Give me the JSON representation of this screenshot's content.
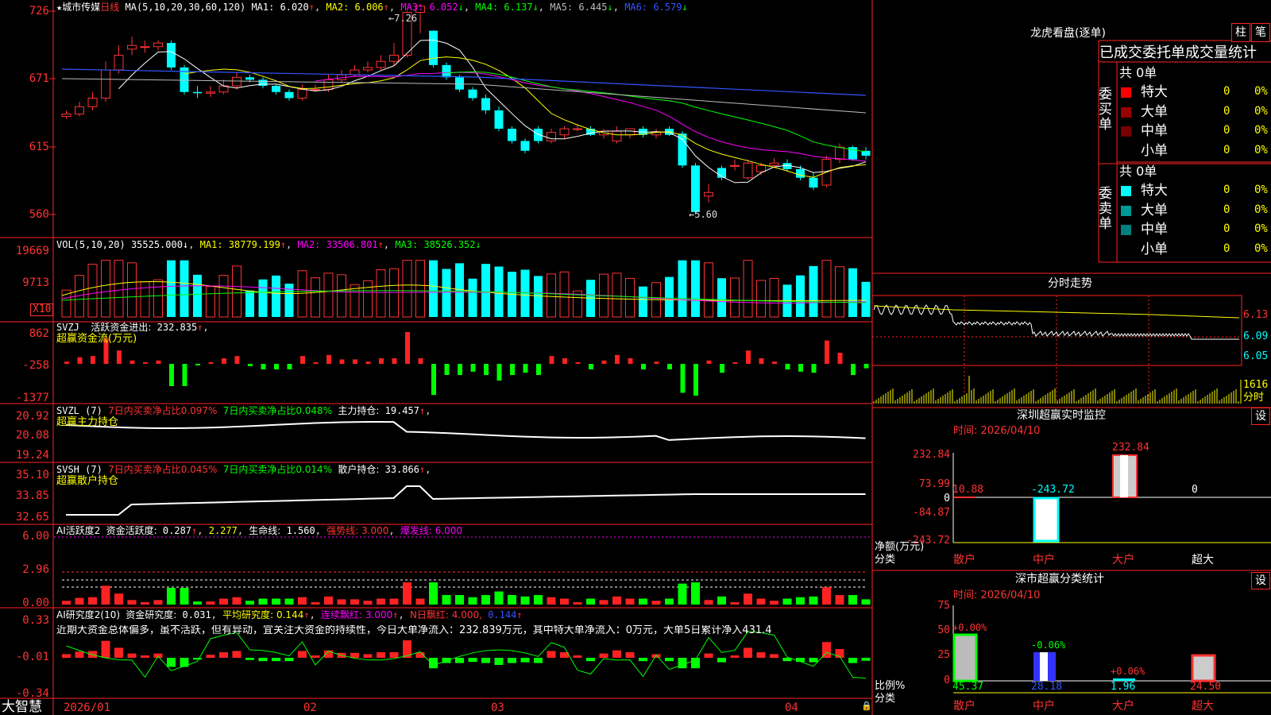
{
  "app_logo": "大智慧",
  "kline": {
    "star": "★",
    "name": "城市传媒",
    "period": "日线",
    "ma_params": "MA(5,10,20,30,60,120)",
    "ma": [
      {
        "label": "MA1:",
        "value": "6.020",
        "arrow": "↑",
        "color": "#ffffff"
      },
      {
        "label": "MA2:",
        "value": "6.006",
        "arrow": "↑",
        "color": "#ffff00"
      },
      {
        "label": "MA3:",
        "value": "6.052",
        "arrow": "↓",
        "color": "#ff00ff"
      },
      {
        "label": "MA4:",
        "value": "6.137",
        "arrow": "↓",
        "color": "#00ff00"
      },
      {
        "label": "MA5:",
        "value": "6.445",
        "arrow": "↓",
        "color": "#bbbbbb"
      },
      {
        "label": "MA6:",
        "value": "6.579",
        "arrow": "↓",
        "color": "#3355ff"
      }
    ],
    "y_ticks": [
      "726",
      "671",
      "615",
      "560"
    ],
    "high_label": "7.26",
    "low_label": "5.60"
  },
  "volume": {
    "params": "VOL(5,10,20)",
    "value": "35525.000",
    "value_arrow": "↓",
    "ma": [
      {
        "label": "MA1:",
        "value": "38779.199",
        "arrow": "↑",
        "color": "#ffff00"
      },
      {
        "label": "MA2:",
        "value": "33506.801",
        "arrow": "↑",
        "color": "#ff00ff"
      },
      {
        "label": "MA3:",
        "value": "38526.352",
        "arrow": "↓",
        "color": "#00ff00"
      }
    ],
    "y_ticks": [
      "19669",
      "9713"
    ],
    "unit": "X10"
  },
  "svzj": {
    "name": "SVZJ",
    "label": "活跃资金进出:",
    "value": "232.835",
    "arrow": "↑",
    "subtitle": "超赢资金流(万元)",
    "y_ticks": [
      "862",
      "-258",
      "-1377"
    ]
  },
  "svzl": {
    "name": "SVZL",
    "param": "(7)",
    "t1": "7日内买卖净占比0.097%",
    "t2": "7日内买卖净占比0.048%",
    "label": "主力持仓:",
    "value": "19.457",
    "subtitle": "超赢主力持仓",
    "y_ticks": [
      "20.92",
      "20.08",
      "19.24"
    ]
  },
  "svsh": {
    "name": "SVSH",
    "param": "(7)",
    "t1": "7日内买卖净占比0.045%",
    "t2": "7日内买卖净占比0.014%",
    "label": "散户持仓:",
    "value": "33.866",
    "subtitle": "超赢散户持仓",
    "y_ticks": [
      "35.10",
      "33.85",
      "32.65"
    ]
  },
  "ai_active": {
    "name": "AI活跃度2",
    "label": "资金活跃度:",
    "v1": "0.287",
    "v2": "2.277",
    "life_label": "生命线:",
    "life_value": "1.560",
    "strong": "强势线: 3.000",
    "burst": "爆发线: 6.000",
    "y_ticks": [
      "6.00",
      "2.96",
      "0.00"
    ]
  },
  "ai_research": {
    "name": "AI研究度2(10)",
    "label": "资金研究度:",
    "value": "0.031",
    "avg": "平均研究度: 0.144",
    "streak": "连续飘红: 3.000",
    "nday": "N日飘红: 4.000,",
    "last": "0.144",
    "comment": "近期大资金总体偏多，虽不活跃，但有异动，宜关注大资金的持续性，今日大单净流入：232.839万元，其中特大单净流入：0万元，大单5日累计净入431.4",
    "y_ticks": [
      "0.33",
      "-0.01",
      "-0.34"
    ]
  },
  "x_axis": [
    "2026/01",
    "02",
    "03",
    "04"
  ],
  "right": {
    "dragon_title": "龙虎看盘(逐单)",
    "btn_zhu": "柱",
    "btn_bi": "笔",
    "stat_title": "已成交委托单成交量统计",
    "buy_side": "委买单",
    "sell_side": "委卖单",
    "buy_total": "共 0单",
    "sell_total": "共 0单",
    "buy_rows": [
      {
        "label": "特大",
        "count": "0",
        "pct": "0%",
        "color": "#ff0000"
      },
      {
        "label": "大单",
        "count": "0",
        "pct": "0%",
        "color": "#990000"
      },
      {
        "label": "中单",
        "count": "0",
        "pct": "0%",
        "color": "#770000"
      },
      {
        "label": "小单",
        "count": "0",
        "pct": "0%",
        "color": "#000000"
      }
    ],
    "sell_rows": [
      {
        "label": "特大",
        "count": "0",
        "pct": "0%",
        "color": "#00ffff"
      },
      {
        "label": "大单",
        "count": "0",
        "pct": "0%",
        "color": "#009999"
      },
      {
        "label": "中单",
        "count": "0",
        "pct": "0%",
        "color": "#008080"
      },
      {
        "label": "小单",
        "count": "0",
        "pct": "0%",
        "color": "#000000"
      }
    ],
    "intraday_title": "分时走势",
    "intraday_prices": [
      "6.13",
      "6.09",
      "6.05"
    ],
    "intraday_vol": "1616",
    "intraday_unit": "分时",
    "monitor_title": "深圳超赢实时监控",
    "monitor_btn": "设",
    "monitor_time": "时间: 2026/04/10",
    "monitor_y": [
      "232.84",
      "73.99",
      "0",
      "-84.87",
      "-243.72"
    ],
    "monitor_bar_vals": [
      "10.88",
      "-243.72",
      "232.84",
      "0"
    ],
    "monitor_ylabel": "净额(万元)",
    "monitor_xlabel": "分类",
    "cats": [
      "散户",
      "中户",
      "大户",
      "超大"
    ],
    "class_title": "深市超赢分类统计",
    "class_btn": "设",
    "class_time": "时间: 2026/04/10",
    "class_y": [
      "75",
      "50",
      "25",
      "0"
    ],
    "class_top": [
      "+0.00%",
      "-0.06%",
      "+0.06%",
      ""
    ],
    "class_vals": [
      "45.37",
      "28.18",
      "1.96",
      "24.50"
    ],
    "class_ylabel": "比例%",
    "class_xlabel": "分类"
  },
  "chart_data": [
    {
      "type": "candlestick",
      "title": "城市传媒 日线",
      "ylim": [
        5.5,
        7.35
      ],
      "open": [
        6.4,
        6.42,
        6.48,
        6.55,
        6.78,
        6.95,
        6.97,
        6.97,
        7.0,
        6.8,
        6.6,
        6.59,
        6.6,
        6.65,
        6.72,
        6.7,
        6.65,
        6.6,
        6.55,
        6.62,
        6.62,
        6.7,
        6.74,
        6.78,
        6.8,
        6.85,
        6.9,
        7.25,
        7.1,
        6.82,
        6.72,
        6.62,
        6.55,
        6.45,
        6.3,
        6.2,
        6.3,
        6.2,
        6.25,
        6.3,
        6.3,
        6.25,
        6.2,
        6.25,
        6.3,
        6.25,
        6.3,
        6.26,
        6.0,
        5.75,
        5.98,
        6.0,
        5.9,
        5.95,
        6.0,
        6.02,
        5.97,
        5.9,
        5.84,
        6.05,
        6.15,
        6.12
      ],
      "close": [
        6.42,
        6.48,
        6.55,
        6.78,
        6.9,
        6.98,
        6.97,
        7.0,
        6.8,
        6.6,
        6.59,
        6.6,
        6.65,
        6.72,
        6.7,
        6.65,
        6.6,
        6.55,
        6.62,
        6.62,
        6.7,
        6.74,
        6.78,
        6.8,
        6.85,
        6.9,
        7.25,
        7.3,
        6.82,
        6.72,
        6.62,
        6.55,
        6.45,
        6.3,
        6.2,
        6.12,
        6.2,
        6.27,
        6.3,
        6.3,
        6.25,
        6.28,
        6.28,
        6.3,
        6.25,
        6.27,
        6.25,
        6.0,
        5.62,
        5.78,
        5.9,
        6.0,
        6.02,
        6.0,
        6.02,
        5.97,
        5.9,
        5.82,
        6.05,
        6.15,
        6.05,
        6.08
      ],
      "high": [
        6.45,
        6.52,
        6.6,
        6.85,
        6.98,
        7.05,
        7.02,
        7.02,
        7.02,
        6.82,
        6.65,
        6.65,
        6.7,
        6.76,
        6.74,
        6.72,
        6.66,
        6.62,
        6.66,
        6.66,
        6.74,
        6.78,
        6.82,
        6.85,
        6.9,
        7.0,
        7.26,
        7.32,
        7.1,
        6.84,
        6.74,
        6.64,
        6.58,
        6.48,
        6.32,
        6.22,
        6.32,
        6.3,
        6.32,
        6.33,
        6.32,
        6.3,
        6.32,
        6.3,
        6.32,
        6.3,
        6.32,
        6.28,
        6.02,
        5.85,
        6.0,
        6.05,
        6.05,
        6.02,
        6.06,
        6.05,
        6.0,
        5.94,
        6.08,
        6.18,
        6.16,
        6.15
      ],
      "low": [
        6.38,
        6.4,
        6.45,
        6.52,
        6.75,
        6.9,
        6.92,
        6.94,
        6.78,
        6.58,
        6.55,
        6.56,
        6.58,
        6.62,
        6.68,
        6.63,
        6.58,
        6.53,
        6.53,
        6.6,
        6.6,
        6.68,
        6.72,
        6.76,
        6.78,
        6.82,
        6.88,
        7.08,
        6.8,
        6.7,
        6.6,
        6.53,
        6.42,
        6.28,
        6.18,
        6.1,
        6.18,
        6.18,
        6.22,
        6.28,
        6.24,
        6.22,
        6.18,
        6.22,
        6.23,
        6.22,
        6.24,
        5.98,
        5.6,
        5.7,
        5.88,
        5.96,
        5.88,
        5.92,
        5.98,
        5.95,
        5.88,
        5.8,
        5.82,
        6.02,
        6.04,
        6.05
      ]
    }
  ]
}
